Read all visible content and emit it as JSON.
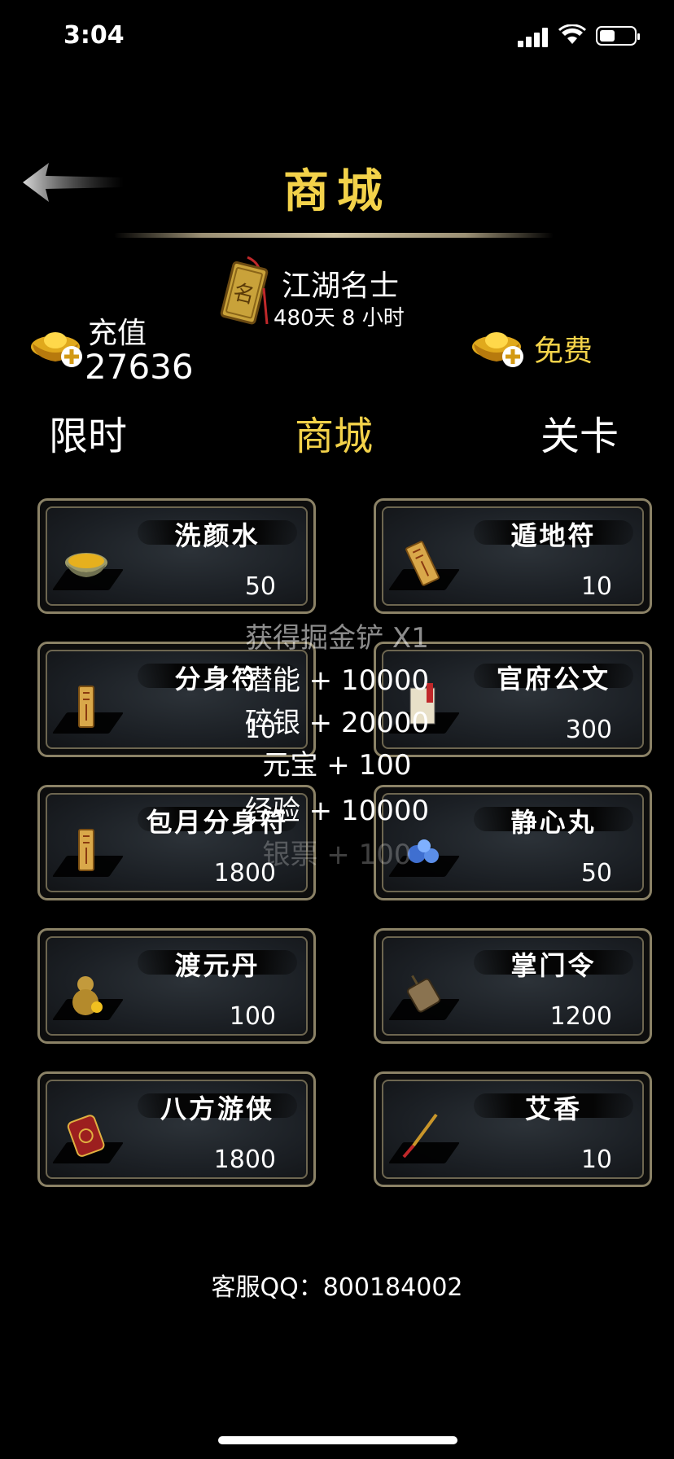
{
  "status_bar": {
    "time": "3:04"
  },
  "header": {
    "title": "商城"
  },
  "rank": {
    "name": "江湖名士",
    "remaining": "480天 8 小时"
  },
  "currency": {
    "recharge_label": "充值",
    "recharge_value": "27636",
    "free_label": "免费"
  },
  "tabs": [
    {
      "label": "限时",
      "active": false
    },
    {
      "label": "商城",
      "active": true
    },
    {
      "label": "关卡",
      "active": false
    }
  ],
  "items": [
    {
      "name": "洗颜水",
      "price": "50",
      "icon": "bowl-icon"
    },
    {
      "name": "遁地符",
      "price": "10",
      "icon": "talisman-icon"
    },
    {
      "name": "分身符",
      "price": "10",
      "icon": "talisman-icon"
    },
    {
      "name": "官府公文",
      "price": "300",
      "icon": "document-icon"
    },
    {
      "name": "包月分身符",
      "price": "1800",
      "icon": "talisman-icon"
    },
    {
      "name": "静心丸",
      "price": "50",
      "icon": "pill-icon"
    },
    {
      "name": "渡元丹",
      "price": "100",
      "icon": "gourd-icon"
    },
    {
      "name": "掌门令",
      "price": "1200",
      "icon": "token-icon"
    },
    {
      "name": "八方游侠",
      "price": "1800",
      "icon": "pouch-icon"
    },
    {
      "name": "艾香",
      "price": "10",
      "icon": "incense-icon"
    }
  ],
  "reward_popup": {
    "lines": [
      "获得掘金铲 X1",
      "潜能 + 10000",
      "碎银 + 20000",
      "元宝 + 100",
      "经验 + 10000",
      "银票 + 100"
    ]
  },
  "footer": {
    "service": "客服QQ：800184002"
  },
  "colors": {
    "accent_gold": "#f3d24a",
    "card_border": "#8b8266",
    "background": "#000000"
  }
}
